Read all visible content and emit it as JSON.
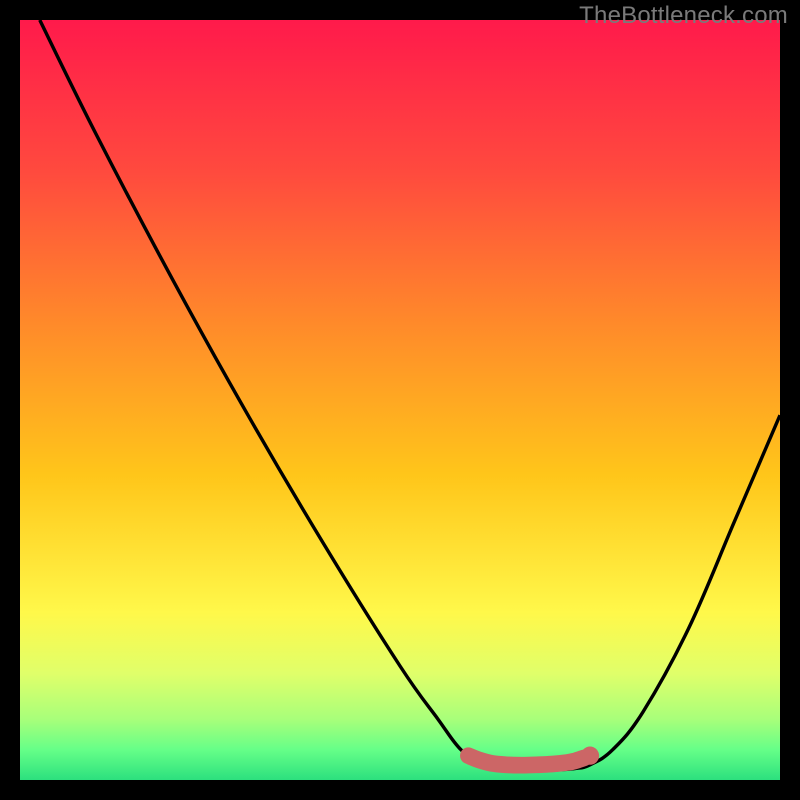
{
  "watermark": "TheBottleneck.com",
  "chart_data": {
    "type": "line",
    "title": "",
    "xlabel": "",
    "ylabel": "",
    "xlim": [
      0,
      100
    ],
    "ylim": [
      0,
      100
    ],
    "gradient_stops": [
      {
        "offset": 0.0,
        "color": "#FF1A4B"
      },
      {
        "offset": 0.2,
        "color": "#FF4A3E"
      },
      {
        "offset": 0.4,
        "color": "#FF8A2A"
      },
      {
        "offset": 0.6,
        "color": "#FFC61A"
      },
      {
        "offset": 0.78,
        "color": "#FFF84A"
      },
      {
        "offset": 0.86,
        "color": "#E0FF6A"
      },
      {
        "offset": 0.92,
        "color": "#A8FF7A"
      },
      {
        "offset": 0.96,
        "color": "#66FF88"
      },
      {
        "offset": 1.0,
        "color": "#2CE07E"
      }
    ],
    "series": [
      {
        "name": "curve",
        "points": [
          {
            "x": 2.6,
            "y": 100.0
          },
          {
            "x": 10.0,
            "y": 85.0
          },
          {
            "x": 20.0,
            "y": 66.0
          },
          {
            "x": 30.0,
            "y": 48.0
          },
          {
            "x": 40.0,
            "y": 31.0
          },
          {
            "x": 50.0,
            "y": 15.0
          },
          {
            "x": 55.0,
            "y": 8.0
          },
          {
            "x": 58.0,
            "y": 4.0
          },
          {
            "x": 61.0,
            "y": 2.0
          },
          {
            "x": 64.0,
            "y": 1.3
          },
          {
            "x": 67.0,
            "y": 1.2
          },
          {
            "x": 70.0,
            "y": 1.3
          },
          {
            "x": 73.0,
            "y": 1.5
          },
          {
            "x": 75.0,
            "y": 2.0
          },
          {
            "x": 78.0,
            "y": 4.0
          },
          {
            "x": 82.0,
            "y": 9.0
          },
          {
            "x": 88.0,
            "y": 20.0
          },
          {
            "x": 94.0,
            "y": 34.0
          },
          {
            "x": 100.0,
            "y": 48.0
          }
        ]
      }
    ],
    "optimal_band": {
      "points": [
        {
          "x": 59.0,
          "y": 3.2
        },
        {
          "x": 60.5,
          "y": 2.6
        },
        {
          "x": 62.0,
          "y": 2.2
        },
        {
          "x": 64.0,
          "y": 2.0
        },
        {
          "x": 66.0,
          "y": 1.95
        },
        {
          "x": 68.0,
          "y": 2.0
        },
        {
          "x": 70.0,
          "y": 2.1
        },
        {
          "x": 72.0,
          "y": 2.3
        },
        {
          "x": 73.0,
          "y": 2.5
        },
        {
          "x": 74.2,
          "y": 2.9
        }
      ],
      "end_dot": {
        "x": 75.0,
        "y": 3.2
      },
      "color": "#CC6666",
      "width": 2.2,
      "dot_r": 1.2
    },
    "colors": {
      "frame": "#000000",
      "curve": "#000000"
    }
  }
}
